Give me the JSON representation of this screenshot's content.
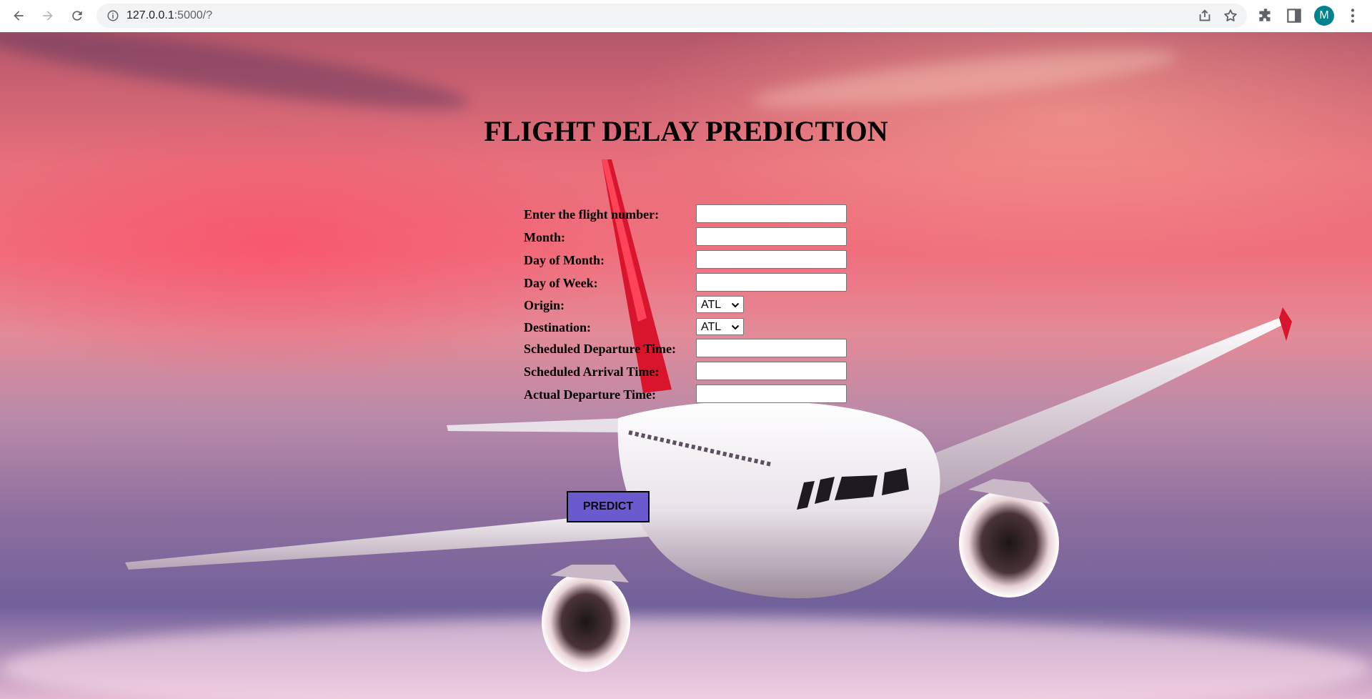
{
  "browser": {
    "url_host": "127.0.0.1",
    "url_rest": ":5000/?",
    "avatar_letter": "M",
    "icons": [
      "back-icon",
      "forward-icon",
      "reload-icon",
      "info-icon",
      "share-icon",
      "star-icon",
      "extensions-icon",
      "side-panel-icon",
      "menu-icon"
    ]
  },
  "page": {
    "title": "FLIGHT DELAY PREDICTION",
    "fields": [
      {
        "label": "Enter the flight number:",
        "type": "text",
        "value": ""
      },
      {
        "label": "Month:",
        "type": "text",
        "value": ""
      },
      {
        "label": "Day of Month:",
        "type": "text",
        "value": ""
      },
      {
        "label": "Day of Week:",
        "type": "text",
        "value": ""
      },
      {
        "label": "Origin:",
        "type": "select",
        "value": "ATL"
      },
      {
        "label": "Destination:",
        "type": "select",
        "value": "ATL"
      },
      {
        "label": "Scheduled Departure Time:",
        "type": "text",
        "value": ""
      },
      {
        "label": "Scheduled Arrival Time:",
        "type": "text",
        "value": ""
      },
      {
        "label": "Actual Departure Time:",
        "type": "text",
        "value": ""
      }
    ],
    "submit_label": "PREDICT",
    "colors": {
      "button": "#6a5acd",
      "avatar": "#00838f"
    }
  }
}
